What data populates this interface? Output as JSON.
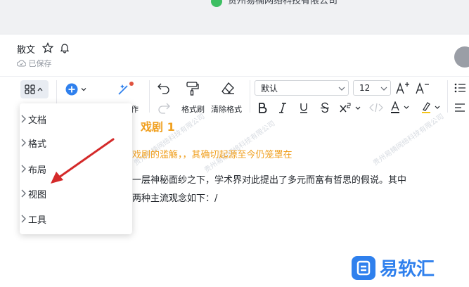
{
  "company": "贵州易楠网络科技有限公司",
  "document": {
    "title": "散文",
    "saved_status": "已保存"
  },
  "toolbar": {
    "font_name": "默认",
    "font_size": "12",
    "format_painter": "格式刷",
    "clear_format": "清除格式",
    "partial_label": "作"
  },
  "menu": {
    "items": [
      "文档",
      "格式",
      "布局",
      "视图",
      "工具"
    ]
  },
  "content": {
    "heading": "戏剧 1",
    "subheading": "戏剧的滥觞，，其确切起源至今仍笼罩在",
    "para_line1": "一层神秘面纱之下，学术界对此提出了多元而富有哲思的假说。其中",
    "para_line2": "两种主流观念如下：/"
  },
  "watermark_text": "贵州易楠网络科技有限公司",
  "brand": "易软汇",
  "colors": {
    "accent": "#2f80ed",
    "heading": "#f0a020",
    "arrow": "#d42a2a",
    "green": "#3dbf62"
  },
  "icons": [
    "grid-icon",
    "add-icon",
    "magic-wand-icon",
    "undo-icon",
    "redo-icon",
    "format-painter-icon",
    "eraser-icon",
    "bold-icon",
    "italic-icon",
    "underline-icon",
    "strikethrough-icon",
    "superscript-icon",
    "code-icon",
    "font-color-icon",
    "highlight-icon",
    "increase-font-icon",
    "decrease-font-icon",
    "list-icon",
    "align-icon",
    "star-icon",
    "bell-icon",
    "cloud-check-icon",
    "chevron-right-icon"
  ]
}
